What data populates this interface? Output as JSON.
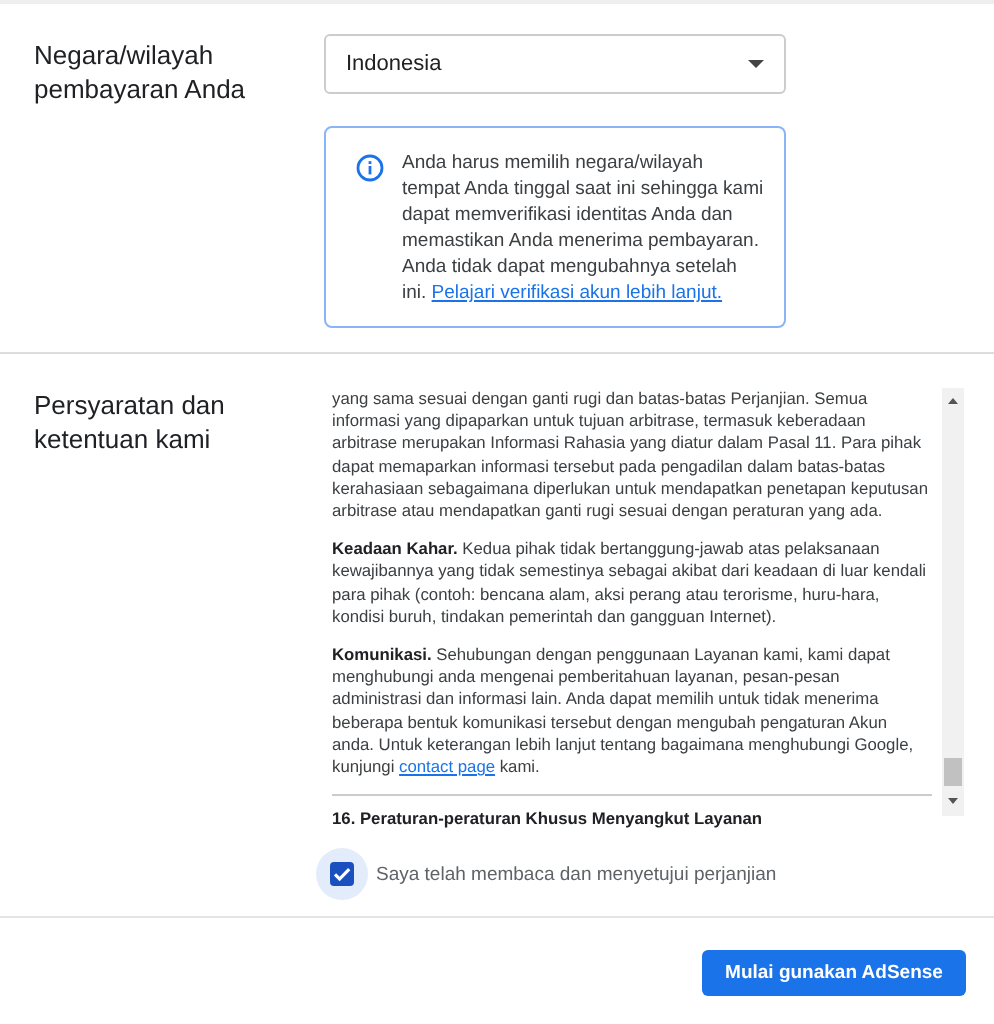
{
  "country": {
    "label": "Negara/wilayah pembayaran Anda",
    "value": "Indonesia"
  },
  "info": {
    "text": "Anda harus memilih negara/wilayah tempat Anda tinggal saat ini sehingga kami dapat memverifikasi identitas Anda dan memastikan Anda menerima pembayaran. Anda tidak dapat mengubahnya setelah ini.",
    "link": "Pelajari verifikasi akun lebih lanjut."
  },
  "terms": {
    "label": "Persyaratan dan ketentuan kami",
    "paragraphs": [
      {
        "text": "yang sama sesuai dengan ganti rugi dan batas-batas Perjanjian. Semua informasi yang dipaparkan untuk tujuan arbitrase, termasuk keberadaan arbitrase merupakan Informasi Rahasia yang diatur dalam Pasal 11. Para pihak dapat memaparkan informasi tersebut pada pengadilan dalam batas-batas kerahasiaan sebagaimana diperlukan untuk mendapatkan penetapan keputusan arbitrase atau mendapatkan ganti rugi sesuai dengan peraturan yang ada."
      },
      {
        "text": "**Keadaan Kahar.** Kedua pihak tidak bertanggung-jawab atas pelaksanaan kewajibannya yang tidak semestinya sebagai akibat dari keadaan di luar kendali para pihak (contoh: bencana alam, aksi perang atau terorisme, huru-hara, kondisi buruh, tindakan pemerintah dan gangguan Internet)."
      },
      {
        "text": "**Komunikasi.** Sehubungan dengan penggunaan Layanan kami, kami dapat menghubungi anda mengenai pemberitahuan layanan, pesan-pesan administrasi dan informasi lain. Anda dapat memilih untuk tidak menerima beberapa bentuk komunikasi tersebut dengan mengubah pengaturan Akun anda. Untuk keterangan lebih lanjut tentang bagaimana menghubungi Google, kunjungi",
        "link": "contact page",
        "after": "kami."
      }
    ],
    "heading": "16. Peraturan-peraturan Khusus Menyangkut Layanan"
  },
  "agree": {
    "label": "Saya telah membaca dan menyetujui perjanjian",
    "checked": true
  },
  "button": "Mulai gunakan AdSense"
}
